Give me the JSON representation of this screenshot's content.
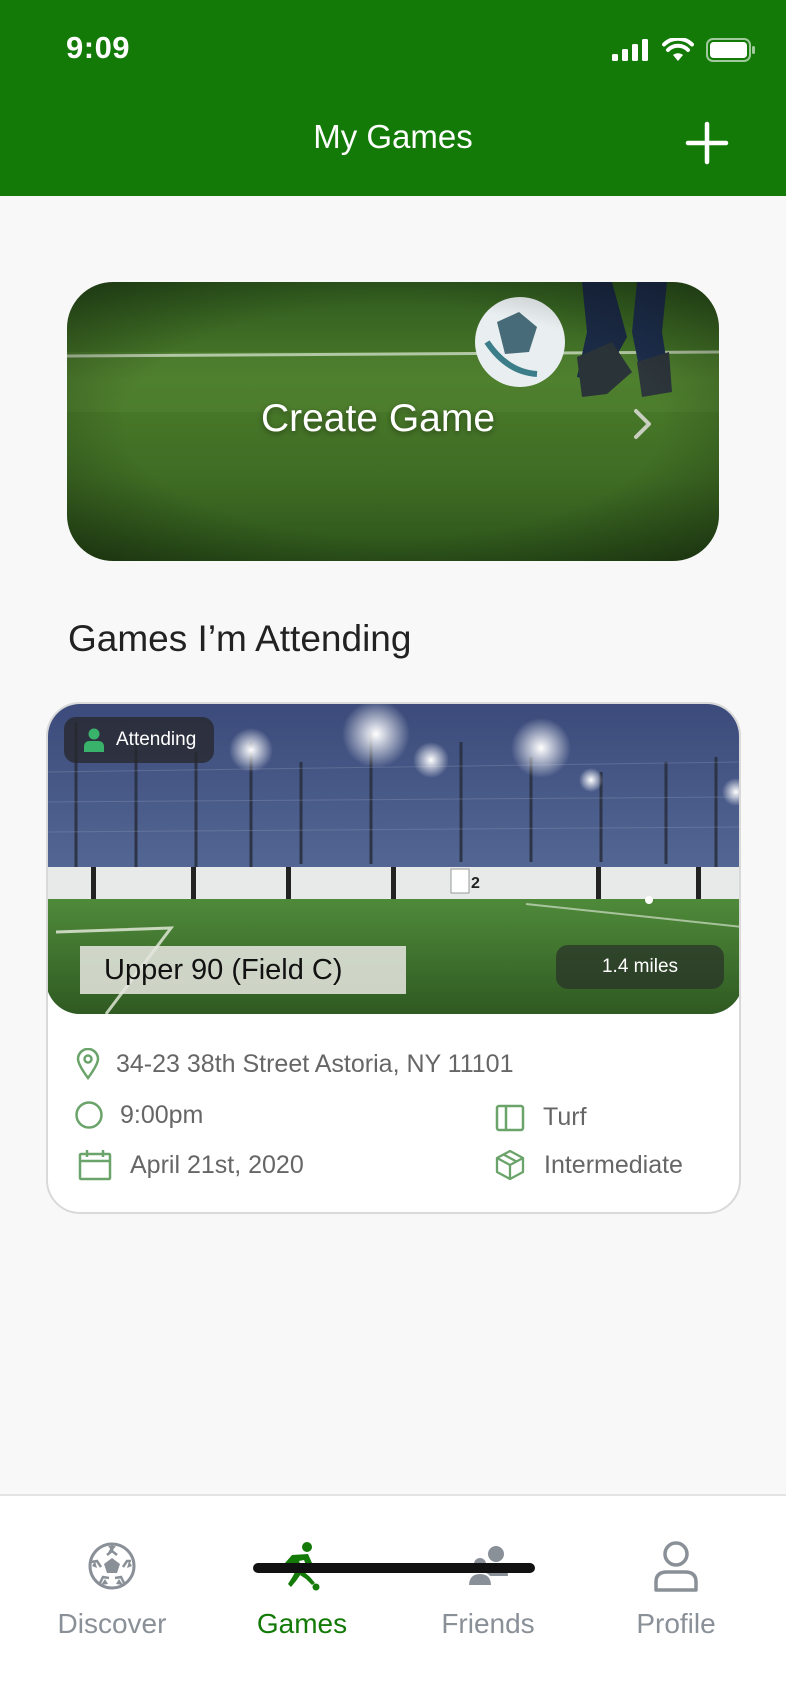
{
  "status_bar": {
    "time": "9:09"
  },
  "header": {
    "title": "My Games"
  },
  "create_card": {
    "label": "Create Game"
  },
  "section": {
    "title": "Games I’m Attending"
  },
  "game": {
    "badge": "Attending",
    "field_name": "Upper 90 (Field C)",
    "distance": "1.4 miles",
    "address": "34-23 38th Street Astoria, NY 11101",
    "time": "9:00pm",
    "surface": "Turf",
    "date": "April 21st, 2020",
    "level": "Intermediate"
  },
  "tabs": [
    {
      "label": "Discover",
      "icon": "soccer-ball-icon"
    },
    {
      "label": "Games",
      "icon": "player-kicking-icon"
    },
    {
      "label": "Friends",
      "icon": "friends-icon"
    },
    {
      "label": "Profile",
      "icon": "person-icon"
    }
  ],
  "colors": {
    "brand_green": "#137a07",
    "icon_green": "#6ba46a",
    "inactive_gray": "#8a9097"
  }
}
